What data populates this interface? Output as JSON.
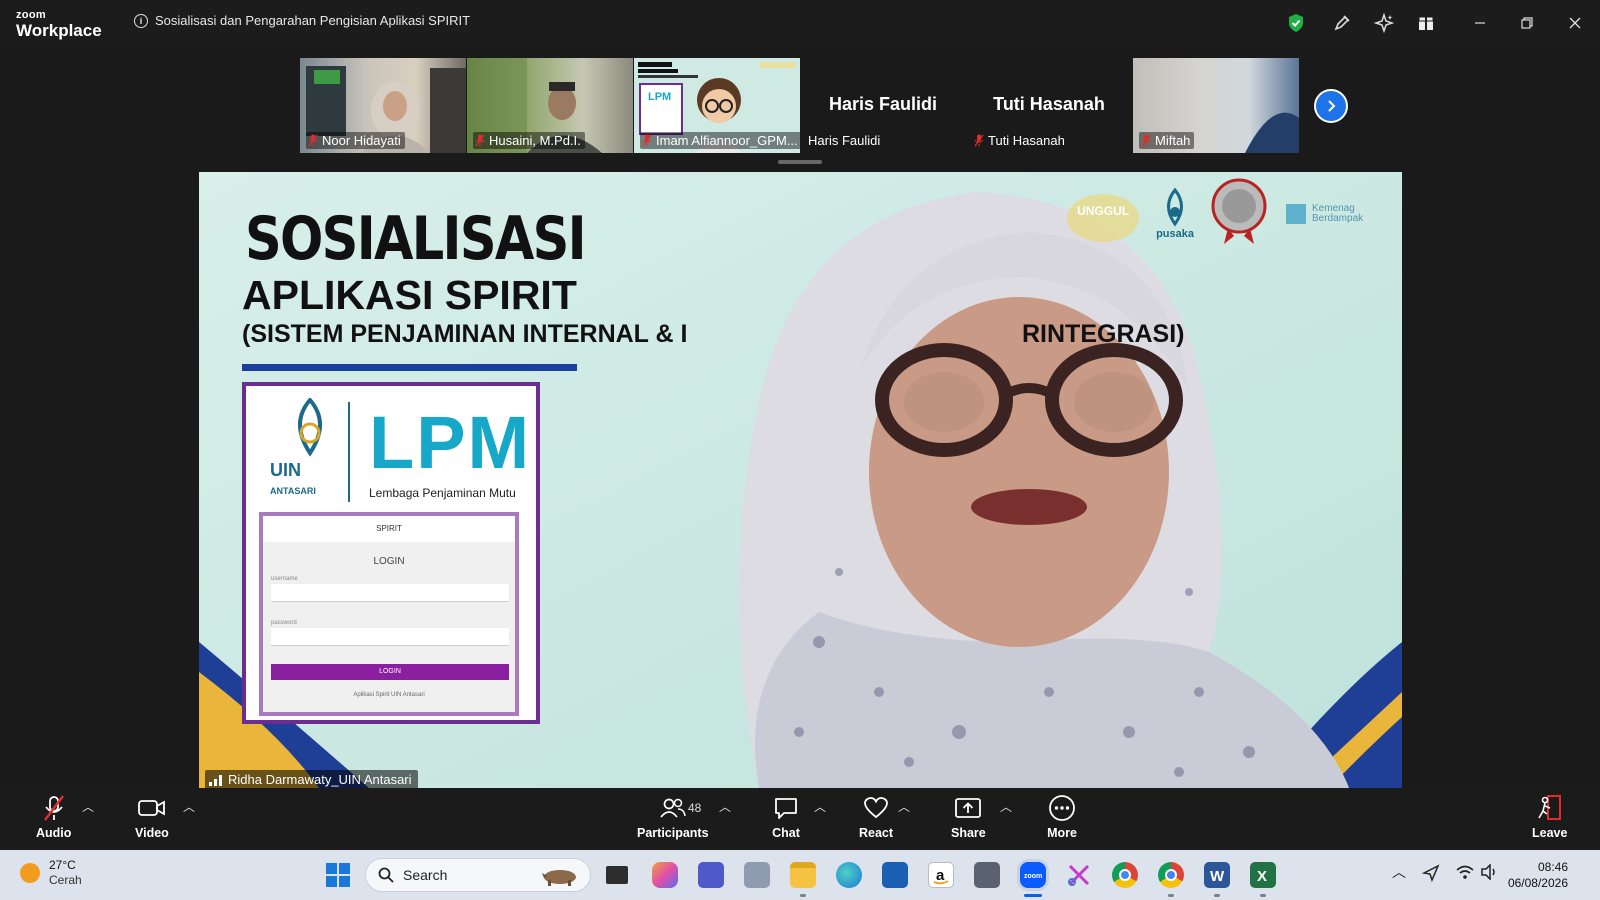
{
  "app": {
    "brand_top": "zoom",
    "brand_bottom": "Workplace"
  },
  "meeting": {
    "title": "Sosialisasi dan Pengarahan Pengisian Aplikasi SPIRIT"
  },
  "colors": {
    "accent": "#1e73e8",
    "shield": "#1fae48",
    "titlebar": "#1c1c1c",
    "toolbar": "#1b1b1b"
  },
  "participants_strip": [
    {
      "name": "Noor Hidayati",
      "muted": true,
      "has_video": true
    },
    {
      "name": "Husaini, M.Pd.I.",
      "muted": true,
      "has_video": true
    },
    {
      "name": "Imam Alfiannoor_GPM...",
      "muted": true,
      "has_video": true
    },
    {
      "name": "Haris Faulidi",
      "display_name": "Haris Faulidi",
      "muted": false,
      "has_video": false
    },
    {
      "name": "Tuti Hasanah",
      "display_name": "Tuti Hasanah",
      "muted": true,
      "has_video": false
    },
    {
      "name": "Miftah",
      "muted": true,
      "has_video": true
    }
  ],
  "slide": {
    "title1": "SOSIALISASI",
    "title2": "APLIKASI SPIRIT",
    "title3_left": "(SISTEM PENJAMINAN INTERNAL & I",
    "title3_right": "RINTEGRASI)",
    "lpm_word": "LPM",
    "lpm_subtitle": "Lembaga Penjaminan Mutu",
    "uin": "UIN",
    "antasari": "ANTASARI",
    "spirit_label": "SPIRIT",
    "login_label": "LOGIN",
    "username_label": "username",
    "password_label": "password",
    "login_button": "LOGIN",
    "footer_link": "Aplikasi Spirit UIN Antasari",
    "logo_unggul": "UNGGUL",
    "logo_pusaka": "pusaka",
    "logo_kemenag": "Kemenag Berdampak"
  },
  "presenter": {
    "name": "Ridha Darmawaty_UIN Antasari"
  },
  "toolbar": {
    "audio": "Audio",
    "video": "Video",
    "participants": "Participants",
    "participants_count": "48",
    "chat": "Chat",
    "react": "React",
    "share": "Share",
    "more": "More",
    "leave": "Leave"
  },
  "taskbar": {
    "temp": "27°C",
    "weather": "Cerah",
    "search_placeholder": "Search",
    "time": "08:46",
    "date": "06/08/2026"
  }
}
